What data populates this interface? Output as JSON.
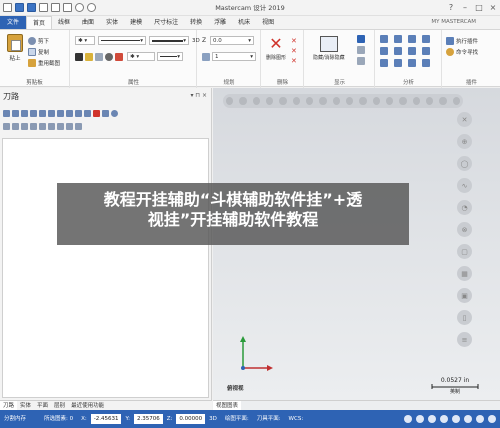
{
  "titlebar": {
    "title": "Mastercam 设计 2019"
  },
  "tabs": [
    {
      "label": "文件"
    },
    {
      "label": "首页"
    },
    {
      "label": "线框"
    },
    {
      "label": "曲面"
    },
    {
      "label": "实体"
    },
    {
      "label": "建模"
    },
    {
      "label": "尺寸标注"
    },
    {
      "label": "转换"
    },
    {
      "label": "浮雕"
    },
    {
      "label": "机床"
    },
    {
      "label": "视图"
    }
  ],
  "account": "MY MASTERCAM",
  "ribbon": {
    "clipboard": {
      "label": "剪贴板",
      "paste": "粘上",
      "cut": "剪下",
      "copy": "复制",
      "paste_special": "重用截图"
    },
    "properties": {
      "label": "属性",
      "three_d": "3D"
    },
    "planning": {
      "label": "规划",
      "z_label": "Z",
      "z_value": "0.0",
      "level_value": "1"
    },
    "delete": {
      "label": "删除",
      "delete_entities": "删除图形"
    },
    "display": {
      "label": "显示",
      "hide": "隐藏/消除隐藏"
    },
    "analyze": {
      "label": "分析"
    },
    "addins": {
      "label": "插件",
      "run_addin": "执行插件",
      "command_finder": "命令寻找"
    }
  },
  "panel": {
    "title": "刀路",
    "controls": "▾ ⊓ ×"
  },
  "viewport": {
    "view_label": "俯视视",
    "scale_value": "0.0527 in",
    "scale_unit": "英制"
  },
  "overlay": {
    "line1": "教程开挂辅助“斗棋辅助软件挂”+透",
    "line2": "视挂”开挂辅助软件教程"
  },
  "bottom_tabs": [
    "刀路",
    "实体",
    "平面",
    "层别",
    "最近使用功能"
  ],
  "viewsheet_tab": "视图图表",
  "status": {
    "section_view": "分割内存",
    "selected": "所选图素: 0",
    "x_label": "X:",
    "x_value": "-2.45631",
    "y_label": "Y:",
    "y_value": "2.35706",
    "z_label": "Z:",
    "z_value": "0.00000",
    "mode": "3D",
    "cplane": "绘图平面:",
    "tplane": "刀具平面:",
    "wcs": "WCS:"
  },
  "colors": {
    "accent": "#2e63b4",
    "overlay": "#565656"
  },
  "icons": {
    "paste": "paste-icon",
    "cut": "scissors-icon",
    "delete": "red-x-icon",
    "axis": "xyz-axis-icon"
  }
}
